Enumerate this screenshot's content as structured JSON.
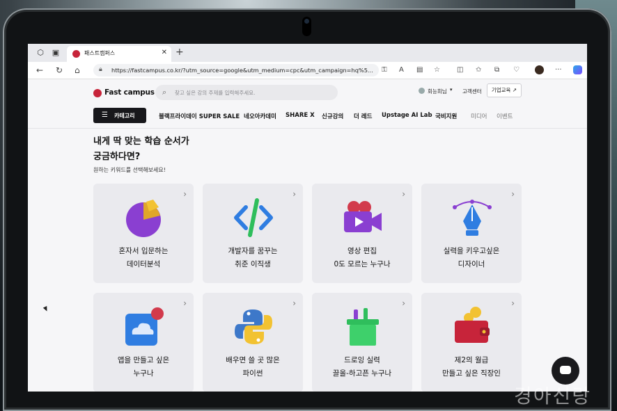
{
  "browser": {
    "tab_title": "패스트캠퍼스",
    "tab_close": "✕",
    "new_tab": "+",
    "url": "https://fastcampus.co.kr/?utm_source=google&utm_medium=cpc&utm_campaign=hq%5..."
  },
  "header": {
    "logo_text": "Fast campus",
    "search_placeholder": "찾고 싶은 강의 주제를 입력해주세요.",
    "user_name": "회능희님",
    "customer_center": "고객센터",
    "business": "기업교육 ↗",
    "category_label": "카테고리"
  },
  "menu": [
    "블랙프라이데이 SUPER SALE",
    "네오아카데미",
    "SHARE X",
    "신규강의",
    "더 레드",
    "Upstage AI Lab",
    "국비지원",
    "미디어",
    "이벤트"
  ],
  "hero": {
    "title_line1": "내게 딱 맞는 학습 순서가",
    "title_line2": "궁금하다면?",
    "subtitle": "원하는 키워드를 선택해보세요!"
  },
  "cards": [
    {
      "line1": "혼자서 입문하는",
      "line2": "데이터분석",
      "icon": "pie-chart-icon"
    },
    {
      "line1": "개발자를 꿈꾸는",
      "line2": "취준 이직생",
      "icon": "code-brackets-icon"
    },
    {
      "line1": "영상 편집",
      "line2": "0도 모르는 누구나",
      "icon": "video-camera-icon"
    },
    {
      "line1": "실력을 키우고싶은",
      "line2": "디자이너",
      "icon": "pen-tool-icon"
    },
    {
      "line1": "앱을 만들고 싶은",
      "line2": "누구나",
      "icon": "cloud-app-icon"
    },
    {
      "line1": "배우면 쓸 곳 많은",
      "line2": "파이썬",
      "icon": "python-icon"
    },
    {
      "line1": "드로잉 실력",
      "line2": "끌올-하고픈 누구나",
      "icon": "paint-bucket-icon"
    },
    {
      "line1": "제2의 월급",
      "line2": "만들고 싶은 직장인",
      "icon": "wallet-icon"
    }
  ],
  "chevron": "›",
  "watermark": "경아신랑",
  "colors": {
    "brand": "#c7243a",
    "dark": "#17171b"
  }
}
